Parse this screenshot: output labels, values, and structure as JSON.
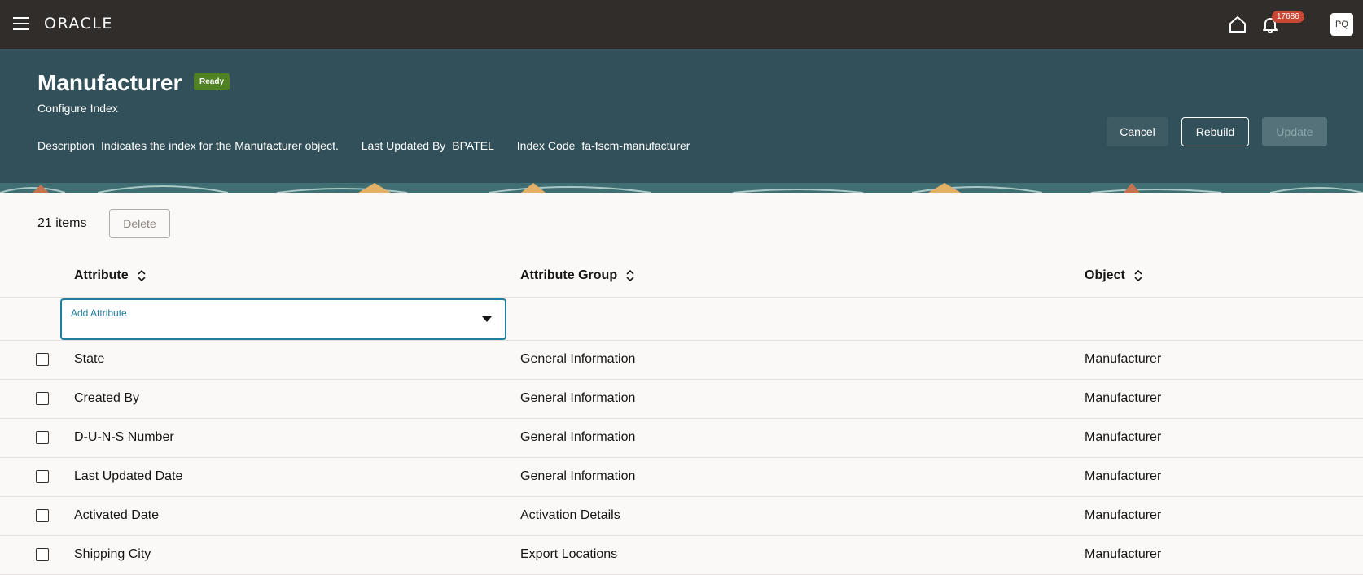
{
  "app": {
    "logo": "ORACLE",
    "notification_count": "17686",
    "avatar_initials": "PQ"
  },
  "header": {
    "title": "Manufacturer",
    "status": "Ready",
    "subtitle": "Configure Index",
    "description_label": "Description",
    "description_value": "Indicates the index for the Manufacturer object.",
    "updated_by_label": "Last Updated By",
    "updated_by_value": "BPATEL",
    "index_code_label": "Index Code",
    "index_code_value": "fa-fscm-manufacturer",
    "cancel_label": "Cancel",
    "rebuild_label": "Rebuild",
    "update_label": "Update"
  },
  "toolbar": {
    "items_count": "21 items",
    "delete_label": "Delete"
  },
  "table": {
    "columns": [
      "Attribute",
      "Attribute Group",
      "Object"
    ],
    "add_attribute_label": "Add Attribute",
    "rows": [
      {
        "attribute": "State",
        "group": "General Information",
        "object": "Manufacturer"
      },
      {
        "attribute": "Created By",
        "group": "General Information",
        "object": "Manufacturer"
      },
      {
        "attribute": "D-U-N-S Number",
        "group": "General Information",
        "object": "Manufacturer"
      },
      {
        "attribute": "Last Updated Date",
        "group": "General Information",
        "object": "Manufacturer"
      },
      {
        "attribute": "Activated Date",
        "group": "Activation Details",
        "object": "Manufacturer"
      },
      {
        "attribute": "Shipping City",
        "group": "Export Locations",
        "object": "Manufacturer"
      }
    ]
  },
  "colors": {
    "topbar": "#312d2a",
    "header": "#325059",
    "status_green": "#508223",
    "badge": "#c74634",
    "focus": "#227e9e"
  }
}
